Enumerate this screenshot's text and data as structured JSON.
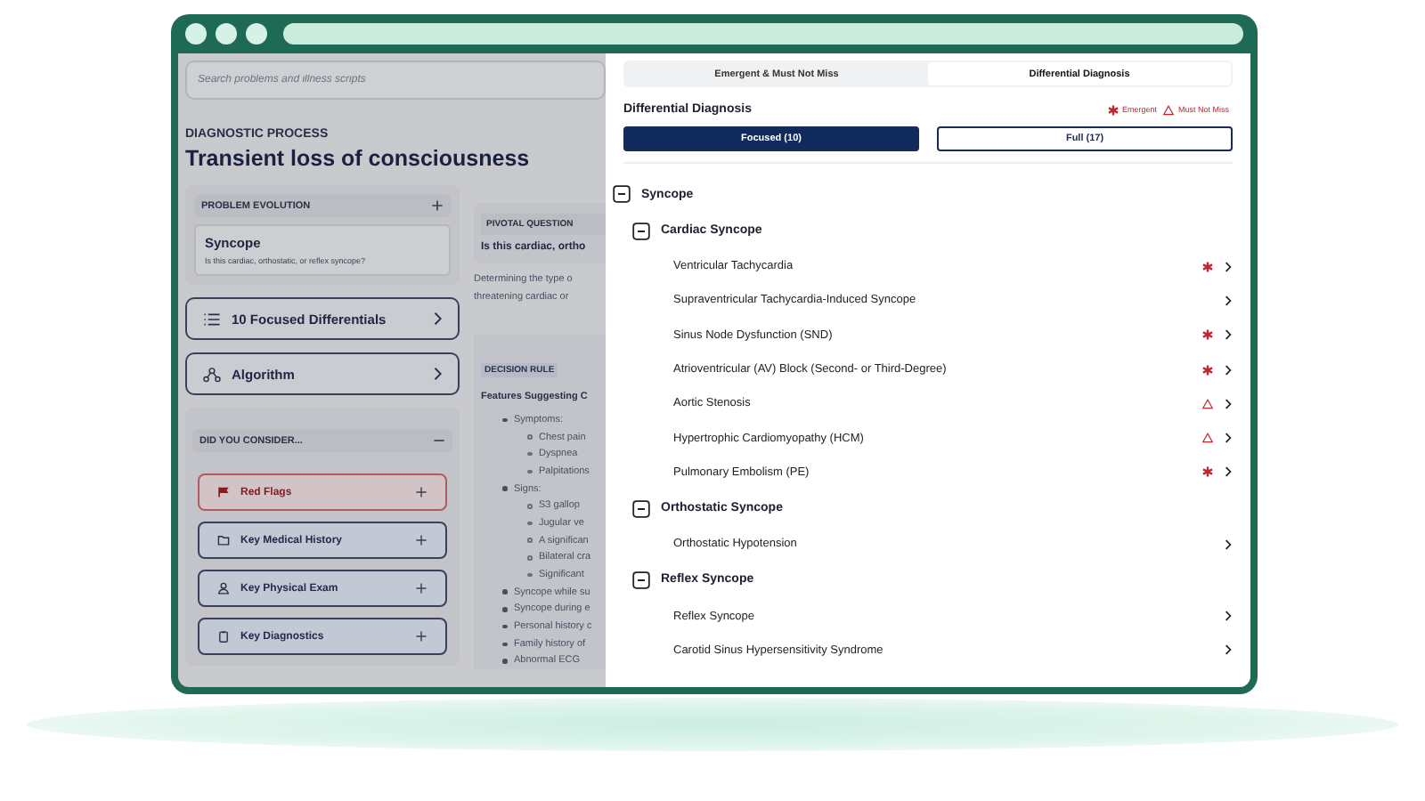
{
  "left_pane": {
    "search": {
      "placeholder": "Search problems and illness scripts"
    },
    "eyebrow": "DIAGNOSTIC PROCESS",
    "title": "Transient loss of consciousness",
    "problem_evolution": {
      "heading": "PROBLEM EVOLUTION",
      "problem": "Syncope",
      "question": "Is this cardiac, orthostatic, or reflex syncope?"
    },
    "nav_buttons": [
      {
        "label": "10 Focused Differentials",
        "kind": "list"
      },
      {
        "label": "Algorithm",
        "kind": "algorithm"
      }
    ],
    "did_you_consider": {
      "heading": "DID YOU CONSIDER...",
      "expanded": true,
      "items": [
        {
          "label": "Red Flags",
          "kind": "flag"
        },
        {
          "label": "Key Medical History",
          "kind": "folder"
        },
        {
          "label": "Key Physical Exam",
          "kind": "person"
        },
        {
          "label": "Key Diagnostics",
          "kind": "clipboard"
        }
      ]
    },
    "pivotal": {
      "heading": "PIVOTAL QUESTION",
      "question": "Is this cardiac, ortho",
      "text_lines": [
        "Determining the type o",
        "threatening cardiac or"
      ]
    },
    "decision_rule": {
      "heading": "DECISION RULE",
      "subheading": "Features Suggesting C",
      "items": [
        {
          "text": "Symptoms:",
          "children": [
            {
              "text": "Chest pain"
            },
            {
              "text": "Dyspnea"
            },
            {
              "text": "Palpitations"
            }
          ]
        },
        {
          "text": "Signs:",
          "children": [
            {
              "text": "S3 gallop"
            },
            {
              "text": "Jugular ve"
            },
            {
              "text": "A significan"
            },
            {
              "text": "Bilateral cra"
            },
            {
              "text": "Significant"
            }
          ]
        },
        {
          "text": "Syncope while su"
        },
        {
          "text": "Syncope during e"
        },
        {
          "text": "Personal history c"
        },
        {
          "text": "Family history of"
        },
        {
          "text": "Abnormal ECG"
        }
      ]
    }
  },
  "right_panel": {
    "tabs": [
      {
        "label": "Emergent & Must Not Miss",
        "selected": false
      },
      {
        "label": "Differential Diagnosis",
        "selected": true
      }
    ],
    "title": "Differential Diagnosis",
    "legend": [
      {
        "kind": "emergent",
        "label": "Emergent"
      },
      {
        "kind": "must_not_miss",
        "label": "Must Not Miss"
      }
    ],
    "filters": [
      {
        "label": "Focused (10)",
        "selected": true
      },
      {
        "label": "Full (17)",
        "selected": false
      }
    ],
    "tree": [
      {
        "label": "Syncope",
        "expanded": true,
        "children": [
          {
            "label": "Cardiac Syncope",
            "expanded": true,
            "children": [
              {
                "label": "Ventricular Tachycardia",
                "kind": "emergent"
              },
              {
                "label": "Supraventricular Tachycardia-Induced Syncope",
                "kind": "none"
              },
              {
                "label": "Sinus Node Dysfunction (SND)",
                "kind": "emergent"
              },
              {
                "label": "Atrioventricular (AV) Block (Second- or Third-Degree)",
                "kind": "emergent"
              },
              {
                "label": "Aortic Stenosis",
                "kind": "must_not_miss"
              },
              {
                "label": "Hypertrophic Cardiomyopathy (HCM)",
                "kind": "must_not_miss"
              },
              {
                "label": "Pulmonary Embolism (PE)",
                "kind": "emergent"
              }
            ]
          },
          {
            "label": "Orthostatic Syncope",
            "expanded": true,
            "children": [
              {
                "label": "Orthostatic Hypotension",
                "kind": "none"
              }
            ]
          },
          {
            "label": "Reflex Syncope",
            "expanded": true,
            "children": [
              {
                "label": "Reflex Syncope",
                "kind": "none"
              },
              {
                "label": "Carotid Sinus Hypersensitivity Syndrome",
                "kind": "none"
              }
            ]
          }
        ]
      }
    ]
  }
}
